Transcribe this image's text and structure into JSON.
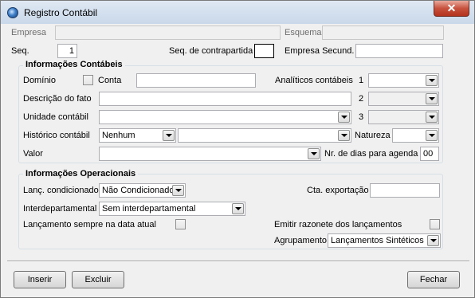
{
  "window": {
    "title": "Registro Contábil",
    "close_symbol": "✕"
  },
  "header": {
    "empresa_label": "Empresa",
    "empresa_value": "",
    "esquema_label": "Esquema",
    "esquema_value": "",
    "seq_label": "Seq.",
    "seq_value": "1",
    "seq_contrapartida_label": "Seq. de contrapartida",
    "seq_contrapartida_value": "",
    "empresa_secund_label": "Empresa Secund.",
    "empresa_secund_value": ""
  },
  "contabeis": {
    "title": "Informações Contábeis",
    "dominio_label": "Domínio",
    "dominio_checked": false,
    "conta_label": "Conta",
    "conta_value": "",
    "analiticos_label": "Analíticos contábeis",
    "analitico_1_num": "1",
    "analitico_1_value": "",
    "analitico_2_num": "2",
    "analitico_2_value": "",
    "analitico_3_num": "3",
    "analitico_3_value": "",
    "descricao_label": "Descrição do fato",
    "descricao_value": "",
    "unidade_label": "Unidade contábil",
    "unidade_value": "",
    "historico_label": "Histórico contábil",
    "historico_value": "Nenhum",
    "historico_text_value": "",
    "natureza_label": "Natureza",
    "natureza_value": "",
    "valor_label": "Valor",
    "valor_value": "",
    "nr_dias_label": "Nr. de dias para agenda",
    "nr_dias_value": "00"
  },
  "operacionais": {
    "title": "Informações Operacionais",
    "lanc_cond_label": "Lanç. condicionado",
    "lanc_cond_value": "Não Condicionado",
    "cta_export_label": "Cta. exportação",
    "cta_export_value": "",
    "interdep_label": "Interdepartamental",
    "interdep_value": "Sem interdepartamental",
    "lanc_data_label": "Lançamento sempre na data atual",
    "lanc_data_checked": false,
    "emitir_label": "Emitir razonete dos lançamentos",
    "emitir_checked": false,
    "agrupamento_label": "Agrupamento",
    "agrupamento_value": "Lançamentos Sintéticos"
  },
  "buttons": {
    "inserir": "Inserir",
    "excluir": "Excluir",
    "fechar": "Fechar"
  }
}
